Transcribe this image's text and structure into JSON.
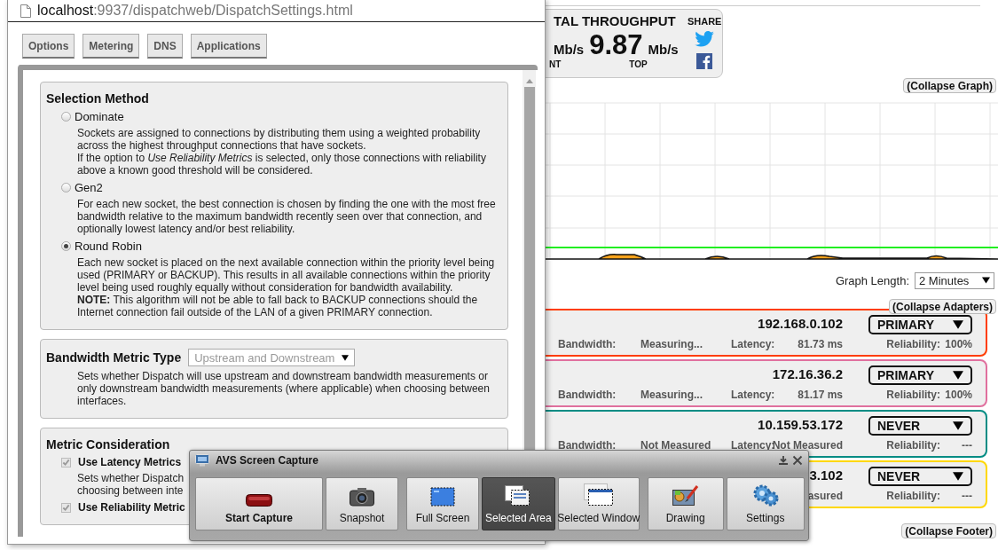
{
  "dashboard": {
    "throughput": {
      "title": "TAL THROUGHPUT",
      "current_unit": "Mb/s",
      "current_caption": "NT",
      "top_value": "9.87",
      "top_unit": "Mb/s",
      "top_caption": "TOP",
      "share_label": "SHARE"
    },
    "collapse_graph": "(Collapse Graph)",
    "graph_length": {
      "label": "Graph Length:",
      "value": "2 Minutes"
    },
    "collapse_adapters": "(Collapse Adapters)",
    "adapters": [
      {
        "ip": "192.168.0.102",
        "priority": "PRIMARY",
        "color": "#ff3d00",
        "bandwidth_label": "Bandwidth:",
        "bandwidth": "Measuring...",
        "latency_label": "Latency:",
        "latency": "81.73 ms",
        "reliability_label": "Reliability:",
        "reliability": "100%"
      },
      {
        "ip": "172.16.36.2",
        "priority": "PRIMARY",
        "color": "#e0709e",
        "bandwidth_label": "Bandwidth:",
        "bandwidth": "Measuring...",
        "latency_label": "Latency:",
        "latency": "81.17 ms",
        "reliability_label": "Reliability:",
        "reliability": "100%"
      },
      {
        "ip": "10.159.53.172",
        "priority": "NEVER",
        "color": "#008c84",
        "bandwidth_label": "Bandwidth:",
        "bandwidth": "Not Measured",
        "latency_label": "Latency:",
        "latency": "Not Measured",
        "reliability_label": "Reliability:",
        "reliability": "---"
      },
      {
        "ip": "3.102",
        "priority": "NEVER",
        "color": "#ffd800",
        "latency": "asured",
        "reliability_label": "Reliability:",
        "reliability": "---"
      }
    ],
    "collapse_footer": "(Collapse Footer)"
  },
  "popup": {
    "address": {
      "host": "localhost",
      "path": ":9937/dispatchweb/DispatchSettings.html"
    },
    "tabs": [
      {
        "label": "Options"
      },
      {
        "label": "Metering"
      },
      {
        "label": "DNS"
      },
      {
        "label": "Applications"
      }
    ],
    "sections": [
      {
        "kind": "radio_group",
        "title": "Selection Method",
        "options": [
          {
            "label": "Dominate",
            "selected": false,
            "paragraphs": [
              "Sockets are assigned to connections by distributing them using a weighted probability across the highest throughput connections that have sockets.",
              "If the option to *Use Reliability Metrics* is selected, only those connections with reliability above a known good threshold will be considered."
            ]
          },
          {
            "label": "Gen2",
            "selected": false,
            "paragraphs": [
              "For each new socket, the best connection is chosen by finding the one with the most free bandwidth relative to the maximum bandwidth recently seen over that connection, and optionally lowest latency and/or best reliability."
            ]
          },
          {
            "label": "Round Robin",
            "selected": true,
            "paragraphs": [
              "Each new socket is placed on the next available connection within the priority level being used (PRIMARY or BACKUP). This results in all available connections within the priority level being used roughly equally without consideration for bandwidth availability.",
              "**NOTE:** This algorithm will not be able to fall back to BACKUP connections should the Internet connection fail outside of the LAN of a given PRIMARY connection."
            ]
          }
        ]
      },
      {
        "kind": "select",
        "title": "Bandwidth Metric Type",
        "select": {
          "value": "Upstream and Downstream",
          "disabled": true
        },
        "paragraphs": [
          "Sets whether Dispatch will use upstream and downstream bandwidth measurements or only downstream bandwidth measurements (where applicable) when choosing between interfaces."
        ]
      },
      {
        "kind": "checkbox_group",
        "title": "Metric Consideration",
        "options": [
          {
            "label": "Use Latency Metrics",
            "checked": true,
            "disabled": true,
            "lines": [
              "Sets whether Dispatch",
              "choosing between inte"
            ]
          },
          {
            "label": "Use Reliability Metric",
            "checked": true,
            "disabled": true
          }
        ]
      }
    ]
  },
  "capture_toolbar": {
    "title": "AVS Screen Capture",
    "groups": [
      {
        "buttons": [
          {
            "kind": "record",
            "label": "Start Capture",
            "selected": false
          },
          {
            "kind": "snapshot",
            "label": "Snapshot",
            "selected": false
          }
        ]
      },
      {
        "buttons": [
          {
            "kind": "full_screen",
            "label": "Full Screen",
            "selected": false
          },
          {
            "kind": "area",
            "label": "Selected Area",
            "selected": true
          },
          {
            "kind": "window",
            "label": "Selected Window",
            "selected": false
          }
        ]
      },
      {
        "buttons": [
          {
            "kind": "drawing",
            "label": "Drawing",
            "selected": false
          },
          {
            "kind": "settings",
            "label": "Settings",
            "selected": false
          }
        ]
      }
    ]
  }
}
